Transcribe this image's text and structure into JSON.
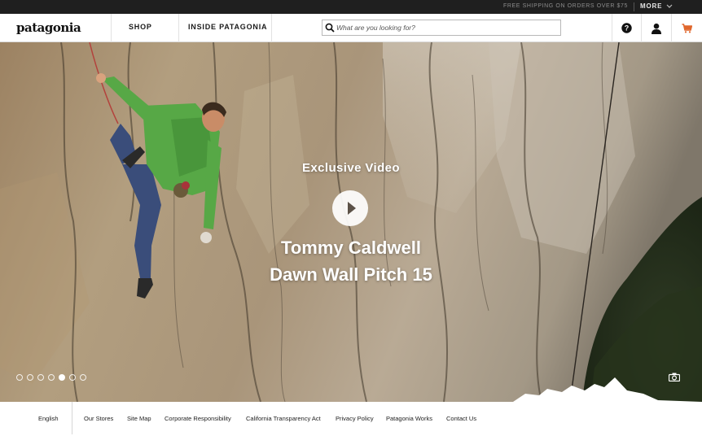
{
  "topbar": {
    "shipping_text": "FREE SHIPPING ON ORDERS OVER $75",
    "more_label": "MORE",
    "more_icon": "chevron-down-icon"
  },
  "header": {
    "logo_text": "patagonia",
    "nav": [
      {
        "label": "SHOP"
      },
      {
        "label": "INSIDE PATAGONIA"
      }
    ],
    "search": {
      "placeholder": "What are you looking for?",
      "icon": "search-icon"
    },
    "icons": [
      "help-icon",
      "account-icon",
      "cart-icon"
    ],
    "cart_color": "#e0662c"
  },
  "hero": {
    "eyebrow": "Exclusive Video",
    "title_line1": "Tommy Caldwell",
    "title_line2": "Dawn Wall Pitch 15",
    "play_icon": "play-icon",
    "camera_icon": "camera-icon",
    "slides_count": 7,
    "active_slide": 5
  },
  "footer": {
    "language": "English",
    "links": [
      "Our Stores",
      "Site Map",
      "Corporate Responsibility",
      "California Transparency Act",
      "Privacy Policy",
      "Patagonia Works",
      "Contact Us"
    ]
  }
}
